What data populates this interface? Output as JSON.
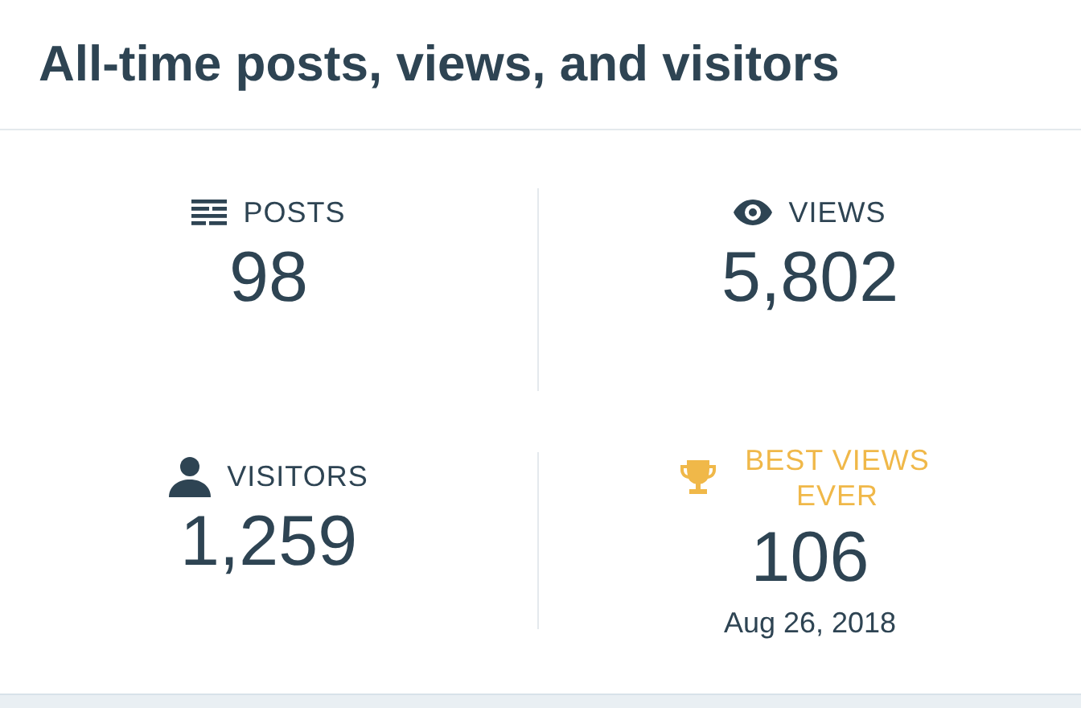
{
  "header": {
    "title": "All-time posts, views, and visitors"
  },
  "stats": [
    {
      "kind": "posts",
      "label": "POSTS",
      "value": "98"
    },
    {
      "kind": "views",
      "label": "VIEWS",
      "value": "5,802"
    },
    {
      "kind": "visitors",
      "label": "VISITORS",
      "value": "1,259"
    },
    {
      "kind": "best",
      "label": "BEST VIEWS EVER",
      "value": "106",
      "date": "Aug 26, 2018"
    }
  ]
}
